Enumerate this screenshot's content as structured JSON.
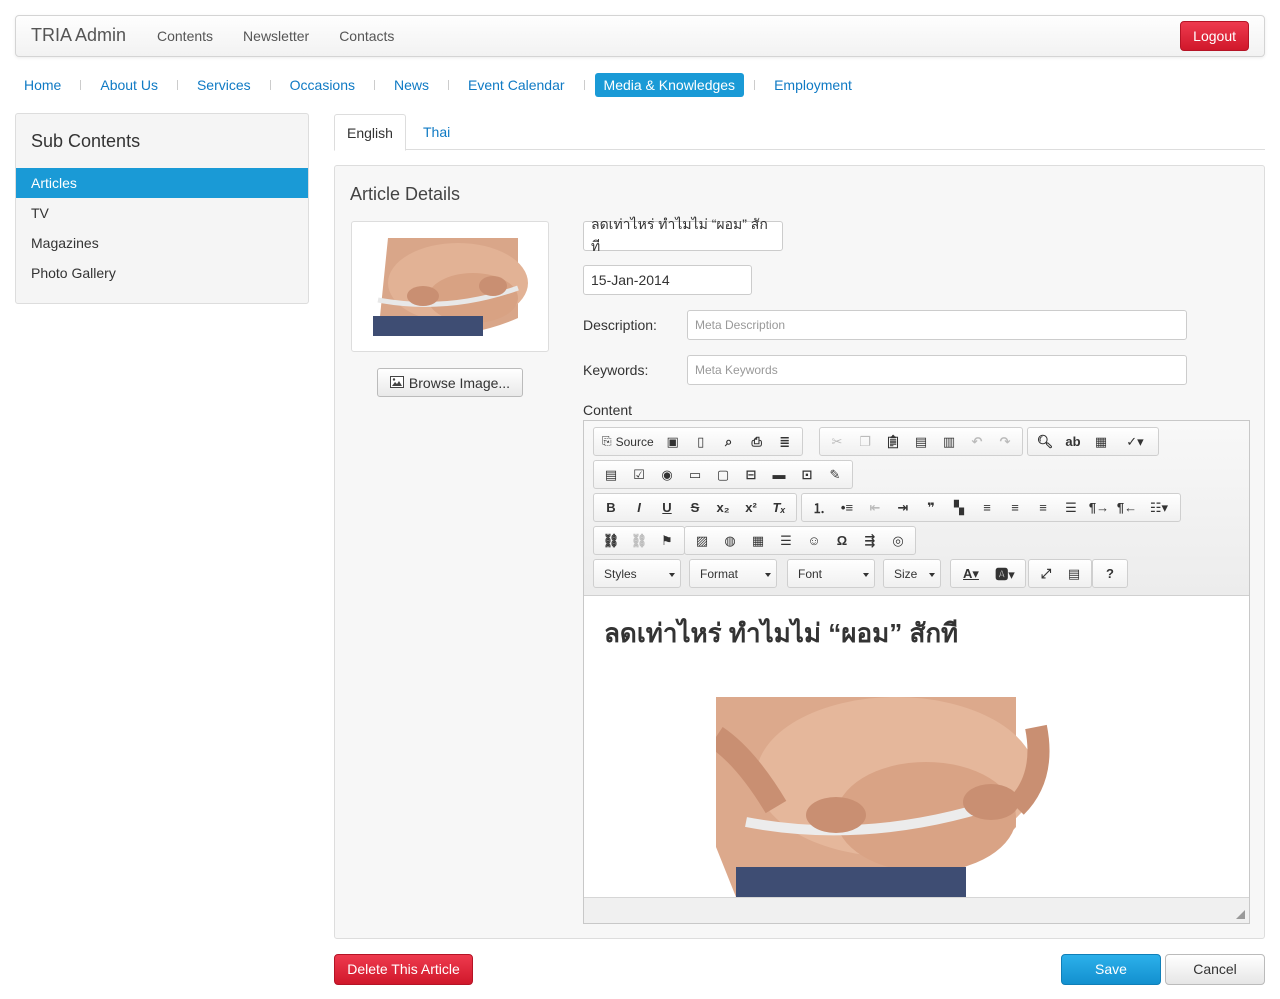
{
  "app": {
    "brand": "TRIA Admin",
    "logout_label": "Logout"
  },
  "topnav": [
    "Contents",
    "Newsletter",
    "Contacts"
  ],
  "subnav": [
    "Home",
    "About Us",
    "Services",
    "Occasions",
    "News",
    "Event Calendar",
    "Media & Knowledges",
    "Employment"
  ],
  "subnav_active": "Media & Knowledges",
  "sidebar": {
    "title": "Sub Contents",
    "items": [
      "Articles",
      "TV",
      "Magazines",
      "Photo Gallery"
    ],
    "active": "Articles"
  },
  "tabs": {
    "english": "English",
    "thai": "Thai"
  },
  "article": {
    "panel_title": "Article Details",
    "browse_label": "Browse Image...",
    "title_value": "ลดเท่าไหร่ ทำไมไม่ “ผอม” สักที",
    "date_value": "15-Jan-2014",
    "description_label": "Description:",
    "description_placeholder": "Meta Description",
    "keywords_label": "Keywords:",
    "keywords_placeholder": "Meta Keywords",
    "content_label": "Content"
  },
  "editor": {
    "source_label": "Source",
    "combo_styles": "Styles",
    "combo_format": "Format",
    "combo_font": "Font",
    "combo_size": "Size",
    "content_heading": "ลดเท่าไหร่ ทำไมไม่ “ผอม” สักที"
  },
  "buttons": {
    "delete": "Delete This Article",
    "save": "Save",
    "cancel": "Cancel"
  },
  "colors": {
    "accent": "#1a9ad6",
    "danger": "#d0182b",
    "link": "#0f7ac4"
  }
}
